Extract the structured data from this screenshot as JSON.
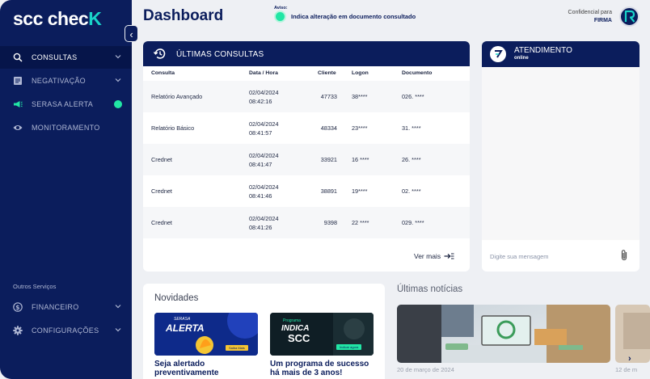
{
  "brand": {
    "logo_main": "scc chec",
    "logo_accent": "K"
  },
  "sidebar": {
    "items": [
      {
        "label": "CONSULTAS"
      },
      {
        "label": "NEGATIVAÇÃO"
      },
      {
        "label": "SERASA ALERTA"
      },
      {
        "label": "MONITORAMENTO"
      }
    ],
    "section_label": "Outros Serviços",
    "bottom_items": [
      {
        "label": "FINANCEIRO"
      },
      {
        "label": "CONFIGURAÇÕES"
      }
    ]
  },
  "header": {
    "title": "Dashboard",
    "aviso_label": "Aviso:",
    "aviso_text": "Indica alteração em documento consultado",
    "conf_label": "Confidencial para",
    "conf_firma": "FIRMA"
  },
  "consultas": {
    "title": "ÚLTIMAS CONSULTAS",
    "columns": [
      "Consulta",
      "Data / Hora",
      "Cliente",
      "Logon",
      "Documento"
    ],
    "rows": [
      {
        "consulta": "Relatório Avançado",
        "data": "02/04/2024",
        "hora": "08:42:16",
        "cliente": "47733",
        "logon": "38****",
        "documento": "026. ****"
      },
      {
        "consulta": "Relatório Básico",
        "data": "02/04/2024",
        "hora": "08:41:57",
        "cliente": "48334",
        "logon": "23****",
        "documento": "31. ****"
      },
      {
        "consulta": "Crednet",
        "data": "02/04/2024",
        "hora": "08:41:47",
        "cliente": "33921",
        "logon": "16 ****",
        "documento": "26. ****"
      },
      {
        "consulta": "Crednet",
        "data": "02/04/2024",
        "hora": "08:41:46",
        "cliente": "38891",
        "logon": "19****",
        "documento": "02. ****"
      },
      {
        "consulta": "Crednet",
        "data": "02/04/2024",
        "hora": "08:41:26",
        "cliente": "9398",
        "logon": "22 ****",
        "documento": "029. ****"
      }
    ],
    "ver_mais": "Ver mais"
  },
  "chat": {
    "title": "ATENDIMENTO",
    "status": "online",
    "placeholder": "Digite sua mensagem"
  },
  "novidades": {
    "title": "Novidades",
    "cards": [
      {
        "banner_small": "SERASA",
        "banner_big": "ALERTA",
        "banner_btn": "Saiba Mais",
        "text_line1": "Seja alertado",
        "text_line2": "preventivamente"
      },
      {
        "banner_small": "Programa",
        "banner_big_1": "INDICA",
        "banner_big_2": "SCC",
        "banner_btn": "Indicar agora",
        "text_line1": "Um programa de sucesso",
        "text_line2": "há mais de 3 anos!"
      }
    ]
  },
  "noticias": {
    "title": "Últimas notícias",
    "items": [
      {
        "date": "20 de março de 2024"
      },
      {
        "date": "12 de m"
      }
    ]
  },
  "colors": {
    "sidebar": "#0b1d5c",
    "accent": "#21e6a5",
    "logo_k": "#19d4c9"
  }
}
